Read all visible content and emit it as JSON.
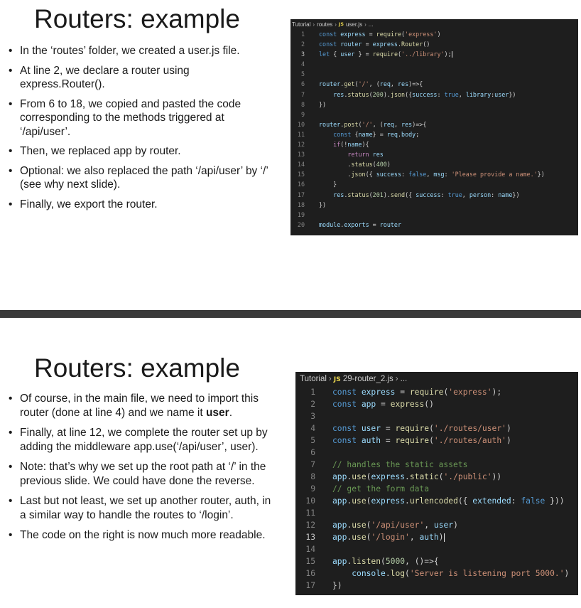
{
  "slide1": {
    "title": "Routers: example",
    "bullets": [
      "In the ‘routes’ folder, we created a user.js file.",
      "At line 2, we declare a router using express.Router().",
      "From 6 to 18, we copied and pasted the code corresponding to the methods triggered at ‘/api/user’.",
      "Then, we replaced app by router.",
      "Optional: we also replaced the path ‘/api/user’ by ‘/’ (see why next slide).",
      "Finally, we export the router."
    ],
    "editor": {
      "breadcrumb": [
        "Tutorial",
        "routes",
        "user.js",
        "..."
      ],
      "file_icon": "JS",
      "active_line": 3,
      "lines": [
        {
          "n": "1",
          "code": "const express = require('express')"
        },
        {
          "n": "2",
          "code": "const router = express.Router()"
        },
        {
          "n": "3",
          "code": "let { user } = require('../library');"
        },
        {
          "n": "4",
          "code": ""
        },
        {
          "n": "5",
          "code": ""
        },
        {
          "n": "6",
          "code": "router.get('/', (req, res)=>{"
        },
        {
          "n": "7",
          "code": "    res.status(200).json({success: true, library:user})"
        },
        {
          "n": "8",
          "code": "})"
        },
        {
          "n": "9",
          "code": ""
        },
        {
          "n": "10",
          "code": "router.post('/', (req, res)=>{"
        },
        {
          "n": "11",
          "code": "    const {name} = req.body;"
        },
        {
          "n": "12",
          "code": "    if(!name){"
        },
        {
          "n": "13",
          "code": "        return res"
        },
        {
          "n": "14",
          "code": "        .status(400)"
        },
        {
          "n": "15",
          "code": "        .json({ success: false, msg: 'Please provide a name.'})"
        },
        {
          "n": "16",
          "code": "    }"
        },
        {
          "n": "17",
          "code": "    res.status(201).send({ success: true, person: name})"
        },
        {
          "n": "18",
          "code": "})"
        },
        {
          "n": "19",
          "code": ""
        },
        {
          "n": "20",
          "code": "module.exports = router"
        }
      ]
    }
  },
  "slide2": {
    "title": "Routers: example",
    "bullets": [
      {
        "pre": "Of course, in the main file, we need to import this router (done at line 4) and we name it ",
        "bold": "user",
        "post": "."
      },
      {
        "pre": "Finally, at line 12, we complete the router set up by adding the middleware app.use(‘/api/user’, user).",
        "bold": "",
        "post": ""
      },
      {
        "pre": "Note: that’s why we set up the root path at ‘/’ in the previous slide. We could have done the reverse.",
        "bold": "",
        "post": ""
      },
      {
        "pre": "Last but not least, we set up another router, auth, in a similar way to handle the routes to ‘/login’.",
        "bold": "",
        "post": ""
      },
      {
        "pre": "The code on the right is now much more readable.",
        "bold": "",
        "post": ""
      }
    ],
    "editor": {
      "breadcrumb": [
        "Tutorial",
        "29-router_2.js",
        "..."
      ],
      "file_icon": "JS",
      "active_line": 13,
      "lines": [
        {
          "n": "1",
          "code": "const express = require('express');"
        },
        {
          "n": "2",
          "code": "const app = express()"
        },
        {
          "n": "3",
          "code": ""
        },
        {
          "n": "4",
          "code": "const user = require('./routes/user')"
        },
        {
          "n": "5",
          "code": "const auth = require('./routes/auth')"
        },
        {
          "n": "6",
          "code": ""
        },
        {
          "n": "7",
          "code": "// handles the static assets"
        },
        {
          "n": "8",
          "code": "app.use(express.static('./public'))"
        },
        {
          "n": "9",
          "code": "// get the form data"
        },
        {
          "n": "10",
          "code": "app.use(express.urlencoded({ extended: false }))"
        },
        {
          "n": "11",
          "code": ""
        },
        {
          "n": "12",
          "code": "app.use('/api/user', user)"
        },
        {
          "n": "13",
          "code": "app.use('/login', auth)"
        },
        {
          "n": "14",
          "code": ""
        },
        {
          "n": "15",
          "code": "app.listen(5000, ()=>{"
        },
        {
          "n": "16",
          "code": "    console.log('Server is listening port 5000.')"
        },
        {
          "n": "17",
          "code": "})"
        }
      ]
    }
  }
}
